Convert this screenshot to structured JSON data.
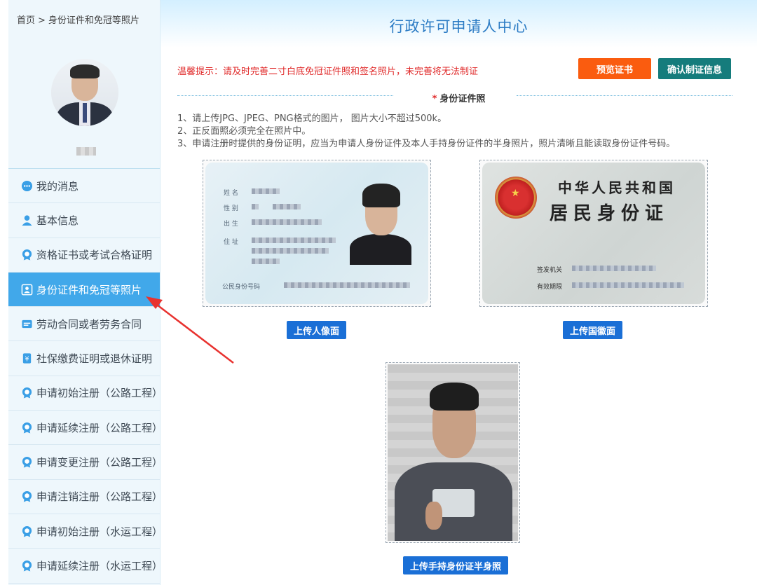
{
  "breadcrumb": {
    "home": "首页",
    "separator": ">",
    "current": "身份证件和免冠等照片"
  },
  "header": {
    "title": "行政许可申请人中心"
  },
  "sidebar": {
    "items": [
      {
        "label": "我的消息",
        "icon": "message-icon"
      },
      {
        "label": "基本信息",
        "icon": "user-icon"
      },
      {
        "label": "资格证书或考试合格证明",
        "icon": "badge-icon"
      },
      {
        "label": "身份证件和免冠等照片",
        "icon": "id-card-icon",
        "active": true
      },
      {
        "label": "劳动合同或者劳务合同",
        "icon": "contract-icon"
      },
      {
        "label": "社保缴费证明或退休证明",
        "icon": "insurance-icon"
      },
      {
        "label": "申请初始注册（公路工程）",
        "icon": "badge-icon"
      },
      {
        "label": "申请延续注册（公路工程）",
        "icon": "badge-icon"
      },
      {
        "label": "申请变更注册（公路工程）",
        "icon": "badge-icon"
      },
      {
        "label": "申请注销注册（公路工程）",
        "icon": "badge-icon"
      },
      {
        "label": "申请初始注册（水运工程）",
        "icon": "badge-icon"
      },
      {
        "label": "申请延续注册（水运工程）",
        "icon": "badge-icon"
      }
    ]
  },
  "main": {
    "tip": "温馨提示：请及时完善二寸白底免冠证件照和签名照片，未完善将无法制证",
    "preview_button": "预览证书",
    "confirm_button": "确认制证信息",
    "section_title_star": "*",
    "section_title": "身份证件照",
    "instructions": [
      "1、请上传JPG、JPEG、PNG格式的图片， 图片大小不超过500k。",
      "2、正反面照必须完全在照片中。",
      "3、申请注册时提供的身份证明，应当为申请人身份证件及本人手持身份证件的半身照片，照片清晰且能读取身份证件号码。"
    ],
    "upload_front_button": "上传人像面",
    "upload_back_button": "上传国徽面",
    "upload_handheld_button": "上传手持身份证半身照"
  },
  "id_front": {
    "name_label": "姓 名",
    "gender_label": "性 别",
    "birth_label": "出 生",
    "address_label": "住 址",
    "number_label": "公民身份号码"
  },
  "id_back": {
    "line1": "中华人民共和国",
    "line2": "居民身份证",
    "authority_label": "签发机关",
    "validity_label": "有效期限"
  },
  "colors": {
    "accent": "#41a8ea",
    "title": "#2b7bc4",
    "tip": "#e02a2a",
    "preview": "#fa5c0f",
    "confirm": "#157c7c",
    "upload": "#1a6fd6",
    "annotation_arrow": "#e8322f"
  }
}
